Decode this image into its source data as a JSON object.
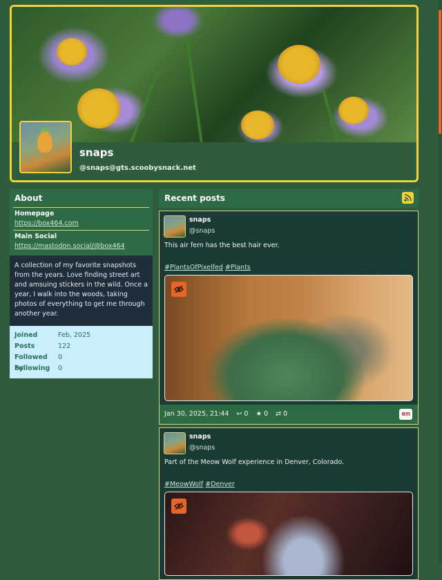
{
  "profile": {
    "display_name": "snaps",
    "handle": "@snaps@gts.scoobysnack.net"
  },
  "about": {
    "title": "About",
    "fields": [
      {
        "name": "Homepage",
        "value": "https://box464.com"
      },
      {
        "name": "Main Social",
        "value": "https://mastodon.social/@box464"
      }
    ],
    "bio": "A collection of my favorite snapshots from the years. Love finding street art and amsuing stickers in the wild. Once a year, I walk into the woods, taking photos of everything to get me through another year.",
    "stats": [
      {
        "label": "Joined",
        "value": "Feb, 2025"
      },
      {
        "label": "Posts",
        "value": "122"
      },
      {
        "label": "Followed by",
        "value": "0"
      },
      {
        "label": "Following",
        "value": "0"
      }
    ]
  },
  "posts_section": {
    "title": "Recent posts",
    "rss_icon": "rss-icon"
  },
  "posts": [
    {
      "name": "snaps",
      "acct": "@snaps",
      "text": "This air fern has the best hair ever.",
      "tags": [
        "#PlantsOfPixelfed",
        "#Plants"
      ],
      "timestamp": "Jan 30, 2025, 21:44",
      "replies": "0",
      "favs": "0",
      "boosts": "0",
      "lang": "en"
    },
    {
      "name": "snaps",
      "acct": "@snaps",
      "text": "Part of the Meow Wolf experience in Denver, Colorado.",
      "tags": [
        "#MeowWolf",
        "#Denver"
      ]
    }
  ],
  "colors": {
    "background": "#2e5c3c",
    "accent": "#f4d339",
    "sensitive": "#e8652a"
  }
}
